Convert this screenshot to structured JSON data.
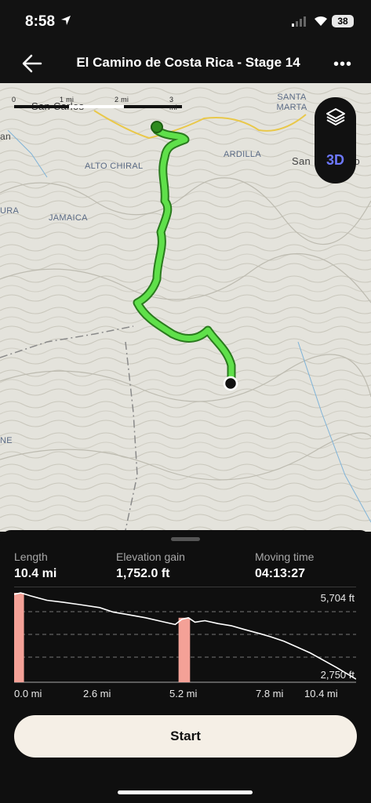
{
  "status": {
    "time": "8:58",
    "battery": "38"
  },
  "header": {
    "title": "El Camino de Costa Rica - Stage 14"
  },
  "map": {
    "scale_labels": [
      "0",
      "1 mi",
      "2 mi",
      "3 mi"
    ],
    "places": [
      "San Carlos",
      "SANTA MARTA",
      "ARDILLA",
      "ALTO CHIRAL",
      "JAMAICA",
      "an",
      "URA",
      "NE",
      "San Francisco"
    ],
    "buttons": {
      "three_d": "3D"
    }
  },
  "stats": {
    "length": {
      "label": "Length",
      "value": "10.4 mi"
    },
    "elevation_gain": {
      "label": "Elevation gain",
      "value": "1,752.0 ft"
    },
    "moving_time": {
      "label": "Moving time",
      "value": "04:13:27"
    }
  },
  "chart_data": {
    "type": "area",
    "title": "",
    "xlabel": "",
    "ylabel": "",
    "x_ticks": [
      "0.0 mi",
      "2.6 mi",
      "5.2 mi",
      "7.8 mi",
      "10.4 mi"
    ],
    "y_labels": [
      "5,704 ft",
      "2,750 ft"
    ],
    "ylim": [
      2750,
      5704
    ],
    "xlim": [
      0,
      10.4
    ],
    "x": [
      0,
      0.2,
      0.5,
      1,
      1.5,
      2,
      2.6,
      3,
      3.5,
      4,
      4.5,
      4.9,
      5.1,
      5.3,
      5.5,
      5.8,
      6.2,
      6.6,
      7,
      7.5,
      7.8,
      8.2,
      8.6,
      9,
      9.4,
      9.8,
      10.1,
      10.4
    ],
    "values": [
      5650,
      5704,
      5600,
      5450,
      5380,
      5300,
      5200,
      5050,
      4950,
      4850,
      4720,
      4620,
      4800,
      4850,
      4700,
      4750,
      4650,
      4580,
      4450,
      4300,
      4200,
      4050,
      3850,
      3650,
      3400,
      3150,
      2950,
      2750
    ],
    "highlights": [
      [
        0,
        0.3
      ],
      [
        5.0,
        5.35
      ]
    ],
    "colors": {
      "line": "#ffffff",
      "highlight": "#f4a197"
    }
  },
  "actions": {
    "start": "Start"
  }
}
